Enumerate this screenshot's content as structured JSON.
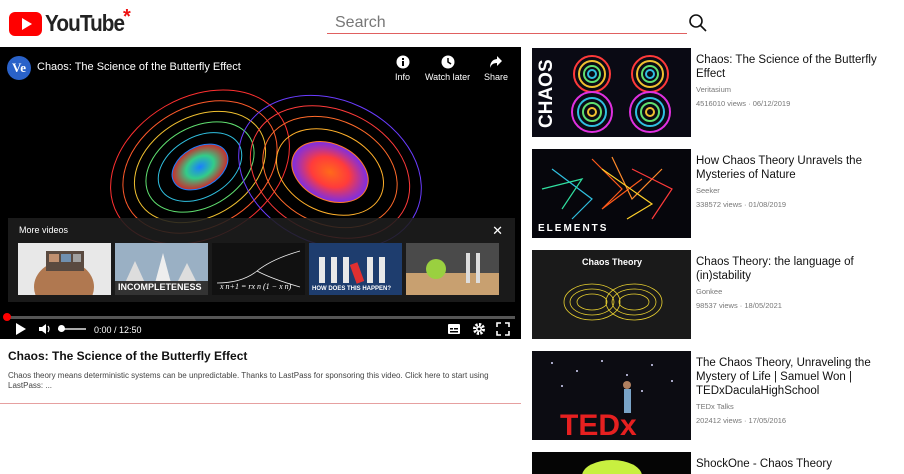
{
  "header": {
    "logo_text": "YouTube",
    "logo_mark": "*",
    "search_placeholder": "Search",
    "search_icon": "magnifier-icon"
  },
  "player": {
    "channel_initials": "Ve",
    "title": "Chaos: The Science of the Butterfly Effect",
    "actions": [
      {
        "label": "Info",
        "icon": "info-icon"
      },
      {
        "label": "Watch later",
        "icon": "clock-icon"
      },
      {
        "label": "Share",
        "icon": "share-icon"
      }
    ],
    "more_videos": {
      "heading": "More videos",
      "thumbs": [
        {
          "label": ""
        },
        {
          "label": "INCOMPLETENESS"
        },
        {
          "label": ""
        },
        {
          "label": "HOW DOES THIS HAPPEN?"
        },
        {
          "label": ""
        }
      ]
    },
    "time": "0:00 / 12:50",
    "progress": 0
  },
  "video": {
    "title": "Chaos: The Science of the Butterfly Effect",
    "description": "Chaos theory means deterministic systems can be unpredictable. Thanks to LastPass for sponsoring this video. Click here to start using LastPass: ..."
  },
  "related": [
    {
      "title": "Chaos: The Science of the Butterfly Effect",
      "channel": "Veritasium",
      "views": "4516010 views",
      "date": "06/12/2019",
      "thumb_text": "CHAOS"
    },
    {
      "title": "How Chaos Theory Unravels the Mysteries of Nature",
      "channel": "Seeker",
      "views": "338572 views",
      "date": "01/08/2019",
      "thumb_text": "ELEMENTS"
    },
    {
      "title": "Chaos Theory: the language of (in)stability",
      "channel": "Gonkee",
      "views": "98537 views",
      "date": "18/05/2021",
      "thumb_text": "Chaos Theory"
    },
    {
      "title": "The Chaos Theory, Unraveling the Mystery of Life | Samuel Won | TEDxDaculaHighSchool",
      "channel": "TEDx Talks",
      "views": "202412 views",
      "date": "17/05/2016",
      "thumb_text": "TEDx"
    },
    {
      "title": "ShockOne - Chaos Theory",
      "channel": "",
      "views": "",
      "date": "",
      "thumb_text": ""
    }
  ],
  "colors": {
    "brand_red": "#ff0000",
    "player_bg": "#000000",
    "meta_gray": "#777777"
  }
}
